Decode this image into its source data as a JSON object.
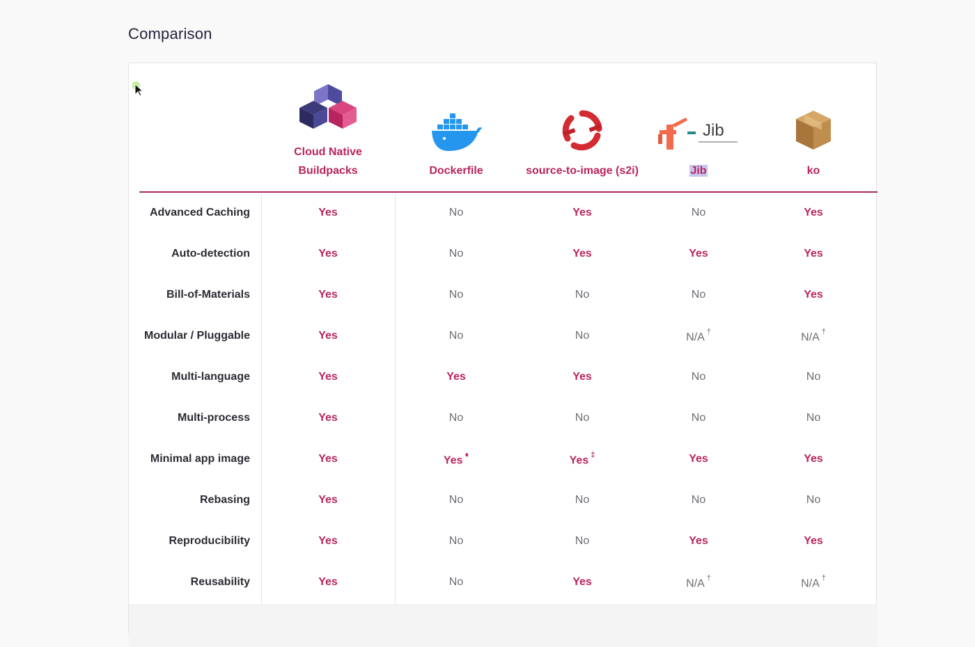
{
  "page_title": "Comparison",
  "columns": [
    {
      "name": "Cloud Native Buildpacks",
      "line1": "Cloud Native",
      "line2": "Buildpacks",
      "logo": "buildpacks-logo"
    },
    {
      "name": "Dockerfile",
      "logo": "docker-whale-logo"
    },
    {
      "name": "source-to-image (s2i)",
      "logo": "openshift-logo"
    },
    {
      "name": "Jib",
      "logo": "jib-logo",
      "logo_text": "Jib"
    },
    {
      "name": "ko",
      "logo": "ko-box-logo"
    }
  ],
  "rows": [
    {
      "label": "Advanced Caching",
      "values": [
        "Yes",
        "No",
        "Yes",
        "No",
        "Yes"
      ],
      "marks": [
        "",
        "",
        "",
        "",
        ""
      ]
    },
    {
      "label": "Auto-detection",
      "values": [
        "Yes",
        "No",
        "Yes",
        "Yes",
        "Yes"
      ],
      "marks": [
        "",
        "",
        "",
        "",
        ""
      ]
    },
    {
      "label": "Bill-of-Materials",
      "values": [
        "Yes",
        "No",
        "No",
        "No",
        "Yes"
      ],
      "marks": [
        "",
        "",
        "",
        "",
        ""
      ]
    },
    {
      "label": "Modular / Pluggable",
      "values": [
        "Yes",
        "No",
        "No",
        "N/A",
        "N/A"
      ],
      "marks": [
        "",
        "",
        "",
        "†",
        "†"
      ]
    },
    {
      "label": "Multi-language",
      "values": [
        "Yes",
        "Yes",
        "Yes",
        "No",
        "No"
      ],
      "marks": [
        "",
        "",
        "",
        "",
        ""
      ]
    },
    {
      "label": "Multi-process",
      "values": [
        "Yes",
        "No",
        "No",
        "No",
        "No"
      ],
      "marks": [
        "",
        "",
        "",
        "",
        ""
      ]
    },
    {
      "label": "Minimal app image",
      "values": [
        "Yes",
        "Yes",
        "Yes",
        "Yes",
        "Yes"
      ],
      "marks": [
        "",
        "♦",
        "‡",
        "",
        ""
      ]
    },
    {
      "label": "Rebasing",
      "values": [
        "Yes",
        "No",
        "No",
        "No",
        "No"
      ],
      "marks": [
        "",
        "",
        "",
        "",
        ""
      ]
    },
    {
      "label": "Reproducibility",
      "values": [
        "Yes",
        "No",
        "No",
        "Yes",
        "Yes"
      ],
      "marks": [
        "",
        "",
        "",
        "",
        ""
      ]
    },
    {
      "label": "Reusability",
      "values": [
        "Yes",
        "No",
        "Yes",
        "N/A",
        "N/A"
      ],
      "marks": [
        "",
        "",
        "",
        "†",
        "†"
      ]
    }
  ],
  "colors": {
    "accent": "#b8255e",
    "no_text": "#6b6b72",
    "border": "#e3e3e8"
  }
}
